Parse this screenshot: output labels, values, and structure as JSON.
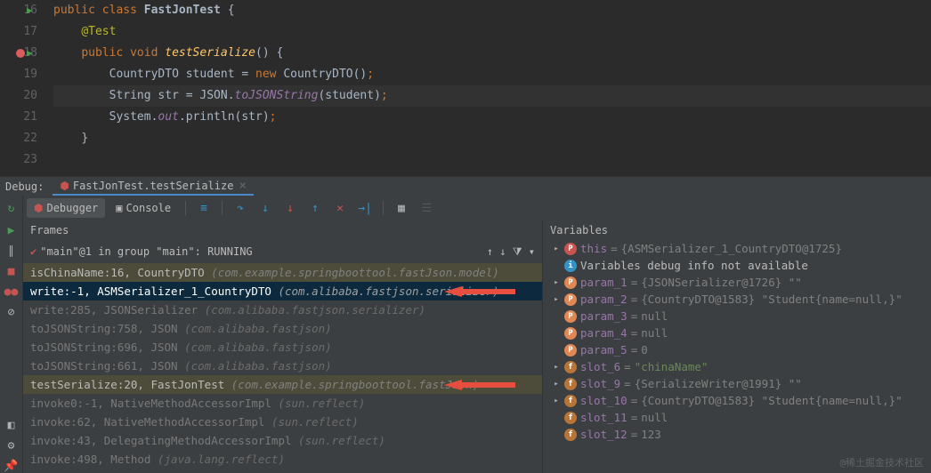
{
  "editor": {
    "lines": [
      {
        "num": "16",
        "run": true,
        "bp": false
      },
      {
        "num": "17",
        "run": false,
        "bp": false
      },
      {
        "num": "18",
        "run": true,
        "bp": true
      },
      {
        "num": "19",
        "run": false,
        "bp": false
      },
      {
        "num": "20",
        "run": false,
        "bp": false
      },
      {
        "num": "21",
        "run": false,
        "bp": false
      },
      {
        "num": "22",
        "run": false,
        "bp": false
      },
      {
        "num": "23",
        "run": false,
        "bp": false
      }
    ],
    "tokens": {
      "l16_kw1": "public",
      "l16_kw2": "class",
      "l16_name": "FastJonTest",
      "l16_brace": "{",
      "l17_ann": "@Test",
      "l18_kw1": "public",
      "l18_kw2": "void",
      "l18_fn": "testSerialize",
      "l18_paren": "()",
      "l18_brace": "{",
      "l19_t1": "CountryDTO",
      "l19_t2": "student",
      "l19_eq": "=",
      "l19_kw": "new",
      "l19_t3": "CountryDTO()",
      "l19_semi": ";",
      "l20_t1": "String",
      "l20_t2": "str",
      "l20_eq": "=",
      "l20_t3": "JSON.",
      "l20_fn": "toJSONString",
      "l20_t4": "(student)",
      "l20_semi": ";",
      "l21_t1": "System.",
      "l21_stat": "out",
      "l21_t2": ".println(str)",
      "l21_semi": ";",
      "l22_brace": "}"
    }
  },
  "debug": {
    "label": "Debug:",
    "tab_name": "FastJonTest.testSerialize",
    "debugger_tab": "Debugger",
    "console_tab": "Console"
  },
  "frames": {
    "title": "Frames",
    "thread": "\"main\"@1 in group \"main\": RUNNING",
    "rows": [
      {
        "text": "isChinaName:16, CountryDTO",
        "pkg": "(com.example.springboottool.fastJson.model)",
        "cls": "yel"
      },
      {
        "text": "write:-1, ASMSerializer_1_CountryDTO",
        "pkg": "(com.alibaba.fastjson.serializer)",
        "cls": "sel",
        "arrow": true
      },
      {
        "text": "write:285, JSONSerializer",
        "pkg": "(com.alibaba.fastjson.serializer)",
        "cls": "dim"
      },
      {
        "text": "toJSONString:758, JSON",
        "pkg": "(com.alibaba.fastjson)",
        "cls": "dim"
      },
      {
        "text": "toJSONString:696, JSON",
        "pkg": "(com.alibaba.fastjson)",
        "cls": "dim"
      },
      {
        "text": "toJSONString:661, JSON",
        "pkg": "(com.alibaba.fastjson)",
        "cls": "dim"
      },
      {
        "text": "testSerialize:20, FastJonTest",
        "pkg": "(com.example.springboottool.fastJson)",
        "cls": "yel",
        "arrow": true
      },
      {
        "text": "invoke0:-1, NativeMethodAccessorImpl",
        "pkg": "(sun.reflect)",
        "cls": "dim"
      },
      {
        "text": "invoke:62, NativeMethodAccessorImpl",
        "pkg": "(sun.reflect)",
        "cls": "dim"
      },
      {
        "text": "invoke:43, DelegatingMethodAccessorImpl",
        "pkg": "(sun.reflect)",
        "cls": "dim"
      },
      {
        "text": "invoke:498, Method",
        "pkg": "(java.lang.reflect)",
        "cls": "dim"
      }
    ]
  },
  "variables": {
    "title": "Variables",
    "rows": [
      {
        "exp": "▸",
        "badge": "p",
        "name": "this",
        "eq": " = ",
        "val": "{ASMSerializer_1_CountryDTO@1725}",
        "cls": ""
      },
      {
        "exp": "",
        "badge": "i",
        "name": "",
        "eq": "",
        "val": "Variables debug info not available",
        "cls": ""
      },
      {
        "exp": "▸",
        "badge": "pp",
        "name": "param_1",
        "eq": " = ",
        "val": "{JSONSerializer@1726} \"\"",
        "cls": ""
      },
      {
        "exp": "▸",
        "badge": "pp",
        "name": "param_2",
        "eq": " = ",
        "val": "{CountryDTO@1583} \"Student{name=null,}\"",
        "cls": ""
      },
      {
        "exp": "",
        "badge": "pp",
        "name": "param_3",
        "eq": " = ",
        "val": "null",
        "cls": ""
      },
      {
        "exp": "",
        "badge": "pp",
        "name": "param_4",
        "eq": " = ",
        "val": "null",
        "cls": ""
      },
      {
        "exp": "",
        "badge": "pp",
        "name": "param_5",
        "eq": " = ",
        "val": "0",
        "cls": ""
      },
      {
        "exp": "▸",
        "badge": "f",
        "name": "slot_6",
        "eq": " = ",
        "val": "\"chinaName\"",
        "cls": "str"
      },
      {
        "exp": "▸",
        "badge": "f",
        "name": "slot_9",
        "eq": " = ",
        "val": "{SerializeWriter@1991} \"\"",
        "cls": ""
      },
      {
        "exp": "▸",
        "badge": "f",
        "name": "slot_10",
        "eq": " = ",
        "val": "{CountryDTO@1583} \"Student{name=null,}\"",
        "cls": ""
      },
      {
        "exp": "",
        "badge": "f",
        "name": "slot_11",
        "eq": " = ",
        "val": "null",
        "cls": ""
      },
      {
        "exp": "",
        "badge": "f",
        "name": "slot_12",
        "eq": " = ",
        "val": "123",
        "cls": ""
      }
    ]
  },
  "watermark": "@稀土掘金技术社区"
}
